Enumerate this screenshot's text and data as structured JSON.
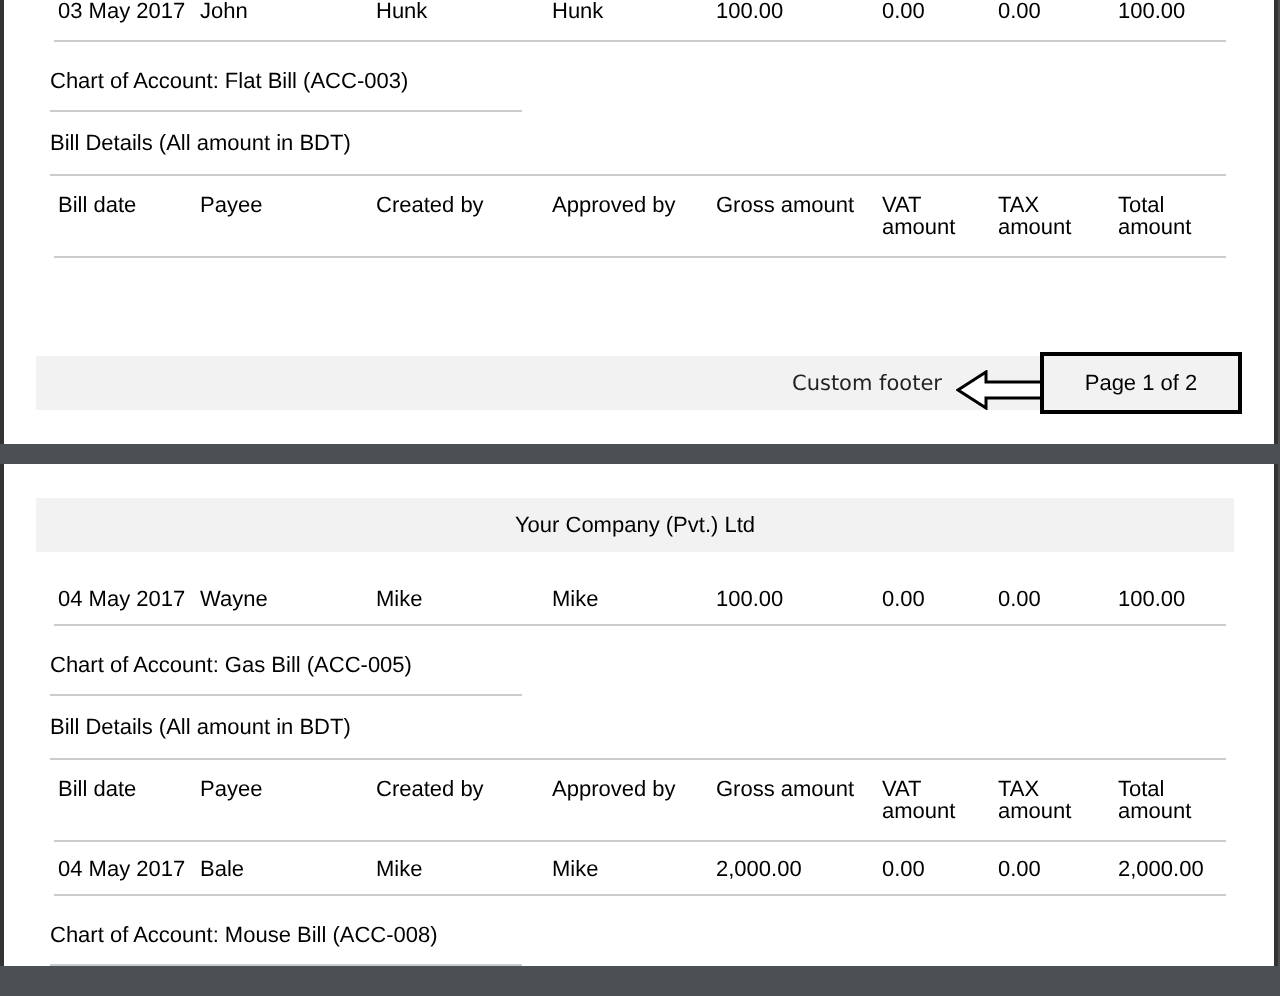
{
  "pages": [
    {
      "blocks": [
        {
          "kind": "row",
          "cells": [
            "03 May 2017",
            "John",
            "Hunk",
            "Hunk",
            "100.00",
            "0.00",
            "0.00",
            "100.00"
          ]
        },
        {
          "kind": "account",
          "text": "Chart of Account: Flat Bill (ACC-003)"
        },
        {
          "kind": "caption",
          "text": "Bill Details (All amount in BDT)"
        },
        {
          "kind": "columns",
          "cells": [
            "Bill date",
            "Payee",
            "Created by",
            "Approved by",
            "Gross amount",
            "VAT amount",
            "TAX amount",
            "Total amount"
          ]
        }
      ],
      "footer": {
        "text": "Custom footer",
        "callout": "Page 1 of 2"
      }
    },
    {
      "header": "Your Company (Pvt.) Ltd",
      "blocks": [
        {
          "kind": "row",
          "cells": [
            "04 May 2017",
            "Wayne",
            "Mike",
            "Mike",
            "100.00",
            "0.00",
            "0.00",
            "100.00"
          ]
        },
        {
          "kind": "account",
          "text": "Chart of Account: Gas Bill (ACC-005)"
        },
        {
          "kind": "caption",
          "text": "Bill Details (All amount in BDT)"
        },
        {
          "kind": "columns",
          "cells": [
            "Bill date",
            "Payee",
            "Created by",
            "Approved by",
            "Gross amount",
            "VAT amount",
            "TAX amount",
            "Total amount"
          ]
        },
        {
          "kind": "row",
          "cells": [
            "04 May 2017",
            "Bale",
            "Mike",
            "Mike",
            "2,000.00",
            "0.00",
            "0.00",
            "2,000.00"
          ]
        },
        {
          "kind": "account",
          "text": "Chart of Account: Mouse Bill (ACC-008)"
        }
      ]
    }
  ]
}
